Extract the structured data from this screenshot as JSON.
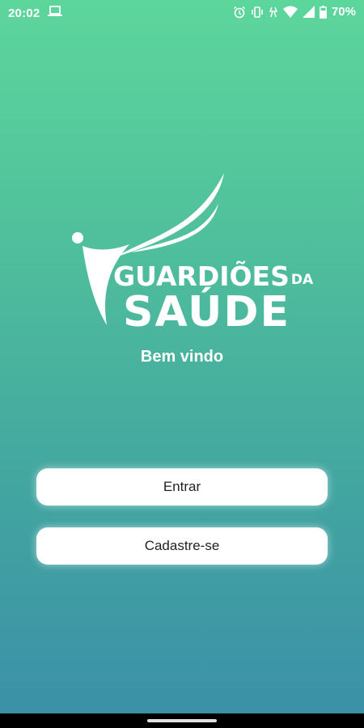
{
  "status_bar": {
    "time": "20:02",
    "battery_percent": "70%",
    "icons": [
      "laptop-icon",
      "alarm-icon",
      "vibrate-icon",
      "data-saver-icon",
      "wifi-icon",
      "signal-icon",
      "battery-icon"
    ]
  },
  "logo": {
    "line1": "GUARDIÕES",
    "line1_suffix": "DA",
    "line2": "SAÚDE"
  },
  "welcome_text": "Bem vindo",
  "buttons": {
    "login_label": "Entrar",
    "signup_label": "Cadastre-se"
  },
  "colors": {
    "gradient_top": "#5dd69c",
    "gradient_bottom": "#3a8fa8",
    "button_bg": "#ffffff",
    "text_light": "#ffffff"
  }
}
